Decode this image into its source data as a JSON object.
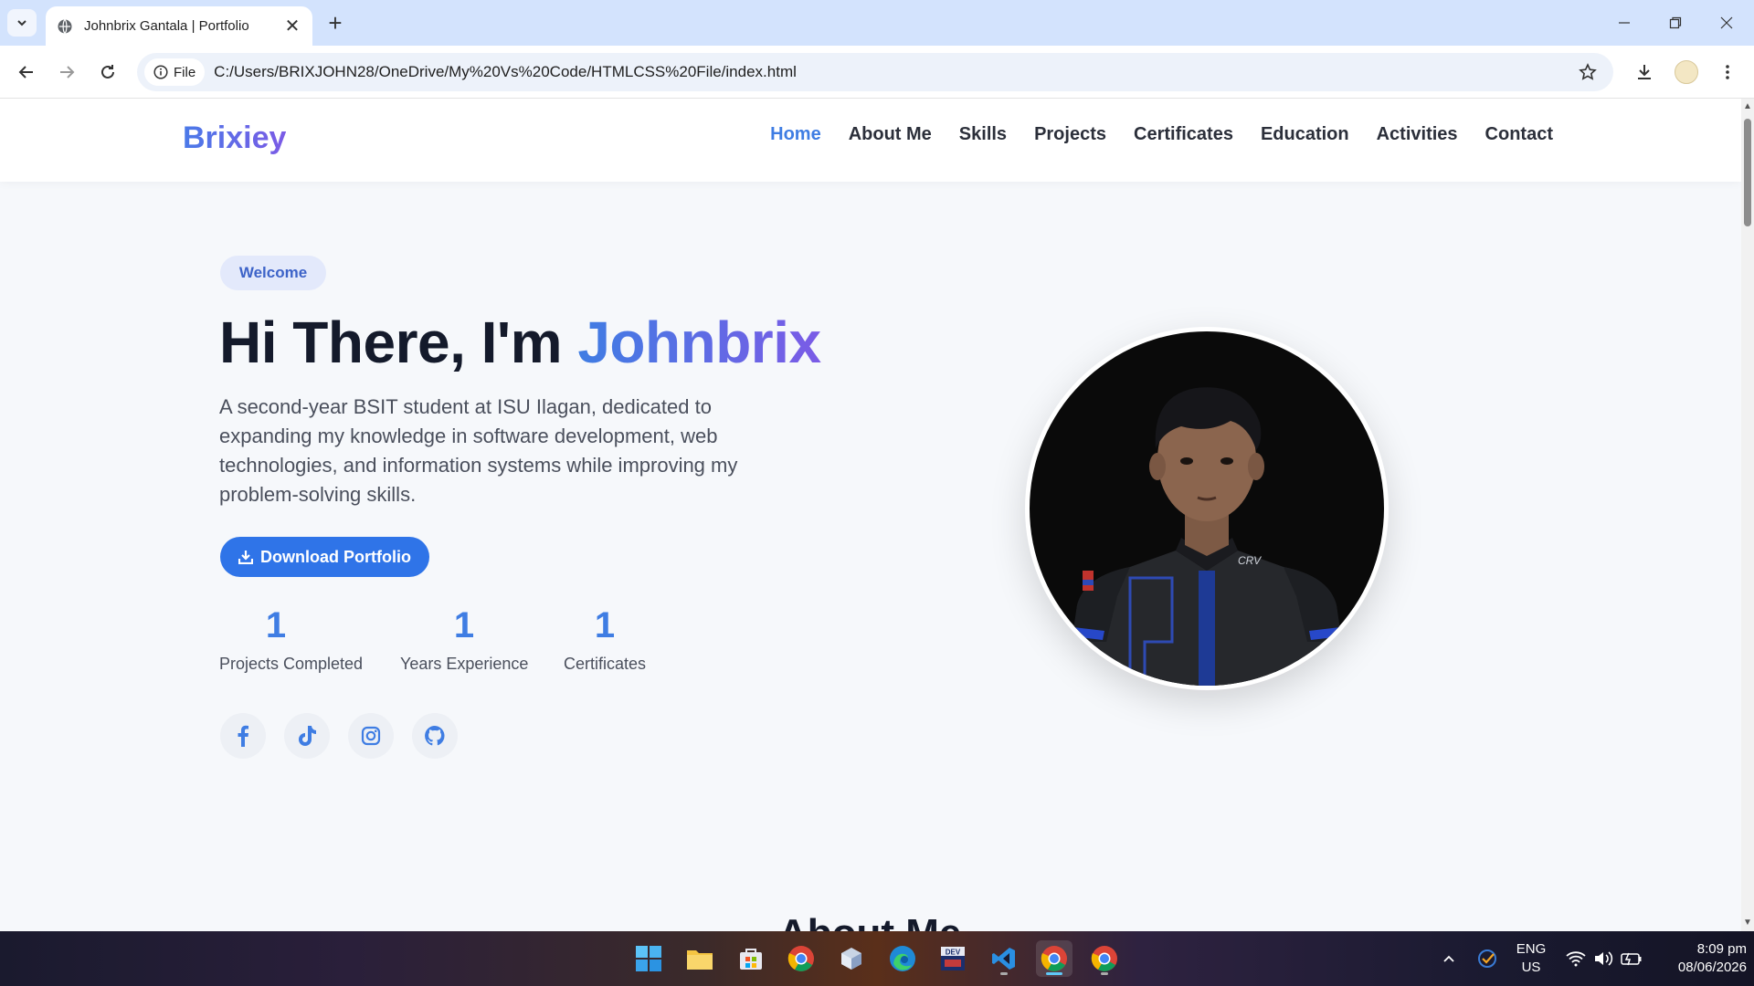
{
  "browser": {
    "tab_title": "Johnbrix Gantala | Portfolio",
    "url_chip": "File",
    "url": "C:/Users/BRIXJOHN28/OneDrive/My%20Vs%20Code/HTMLCSS%20File/index.html"
  },
  "site": {
    "logo": "Brixiey",
    "nav": [
      "Home",
      "About Me",
      "Skills",
      "Projects",
      "Certificates",
      "Education",
      "Activities",
      "Contact"
    ],
    "active_nav": "Home"
  },
  "hero": {
    "badge": "Welcome",
    "title_prefix": "Hi There, I'm ",
    "title_name": "Johnbrix",
    "description": "A second-year BSIT student at ISU Ilagan, dedicated to expanding my knowledge in software development, web technologies, and information systems while improving my problem-solving skills.",
    "download_label": "Download Portfolio",
    "stats": [
      {
        "value": "1",
        "label": "Projects Completed"
      },
      {
        "value": "1",
        "label": "Years Experience"
      },
      {
        "value": "1",
        "label": "Certificates"
      }
    ],
    "socials": [
      "facebook-icon",
      "tiktok-icon",
      "instagram-icon",
      "github-icon"
    ]
  },
  "next_section_title": "About Me",
  "taskbar": {
    "language": "ENG",
    "region": "US",
    "time": "8:09 pm",
    "date": "08/06/2026"
  },
  "colors": {
    "accent": "#3f7de3",
    "accent_purple": "#7b5be6",
    "button": "#2f74e8",
    "heading": "#141a2b"
  }
}
